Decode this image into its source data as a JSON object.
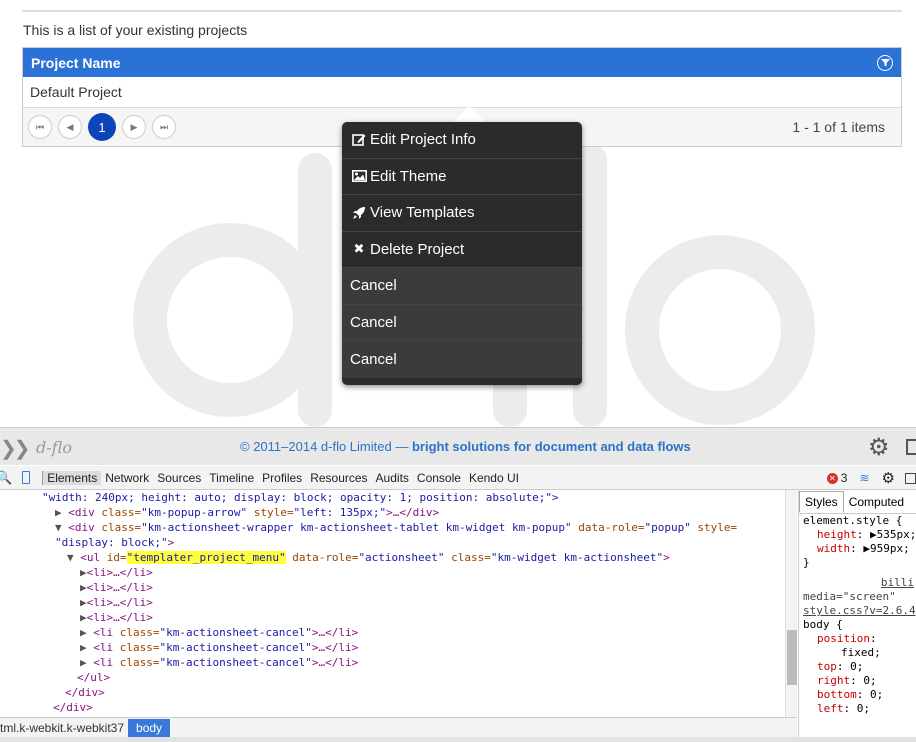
{
  "page": {
    "intro": "This is a list of your existing projects",
    "grid": {
      "column_header": "Project Name",
      "rows": [
        "Default Project"
      ],
      "pager": {
        "current_page": "1",
        "info": "1 - 1 of 1 items"
      }
    }
  },
  "popup_menu": {
    "items": [
      {
        "label": "Edit Project Info",
        "icon": "edit-icon"
      },
      {
        "label": "Edit Theme",
        "icon": "image-icon"
      },
      {
        "label": "View Templates",
        "icon": "rocket-icon"
      },
      {
        "label": "Delete Project",
        "icon": "close-icon"
      }
    ],
    "cancel_items": [
      "Cancel",
      "Cancel",
      "Cancel"
    ]
  },
  "devtools": {
    "banner": {
      "logo": "d-flo",
      "copyright": "© 2011–2014 d-flo Limited —",
      "tagline": "bright solutions for document and data flows"
    },
    "tabs": [
      "Elements",
      "Network",
      "Sources",
      "Timeline",
      "Profiles",
      "Resources",
      "Audits",
      "Console",
      "Kendo UI"
    ],
    "error_count": "3",
    "code": {
      "l0": "\"width: 240px; height: auto; display: block; opacity: 1; position: absolute;\">",
      "l1_tag": "<div ",
      "l1_attr": "class=",
      "l1_val": "\"km-popup-arrow\"",
      "l1_attr2": " style=",
      "l1_val2": "\"left: 135px;\"",
      "l1_end": ">…</div>",
      "l2_tag": "<div ",
      "l2_attr": "class=",
      "l2_val": "\"km-actionsheet-wrapper km-actionsheet-tablet km-widget km-popup\"",
      "l2_attr2": " data-role=",
      "l2_val2": "\"popup\"",
      "l2_attr3": " style=",
      "l3_val": "\"display: block;\"",
      "l3_end": ">",
      "l4_tag": "<ul ",
      "l4_attr": "id=",
      "l4_val": "\"templater_project_menu\"",
      "l4_attr2": " data-role=",
      "l4_val2": "\"actionsheet\"",
      "l4_attr3": " class=",
      "l4_val3": "\"km-widget km-actionsheet\"",
      "l4_end": ">",
      "li": "<li>…</li>",
      "li_cancel_tag": "<li ",
      "li_cancel_attr": "class=",
      "li_cancel_val": "\"km-actionsheet-cancel\"",
      "li_cancel_end": ">…</li>",
      "ul_close": "</ul>",
      "div_close": "</div>"
    },
    "styles": {
      "tabs": [
        "Styles",
        "Computed"
      ],
      "element_style": "element.style {",
      "height_prop": "height",
      "height_val": "535px;",
      "width_prop": "width",
      "width_val": "959px;",
      "close": "}",
      "billing": "billi",
      "media": "media=\"screen\"",
      "css_link": "style.css?v=2.6.4",
      "body_sel": "body {",
      "position_prop": "position",
      "position_val": "fixed;",
      "top_prop": "top",
      "top_val": "0;",
      "right_prop": "right",
      "right_val": "0;",
      "bottom_prop": "bottom",
      "bottom_val": "0;",
      "left_prop": "left",
      "left_val": "0;"
    },
    "breadcrumb": [
      "tml.k-webkit.k-webkit37",
      "body"
    ]
  }
}
